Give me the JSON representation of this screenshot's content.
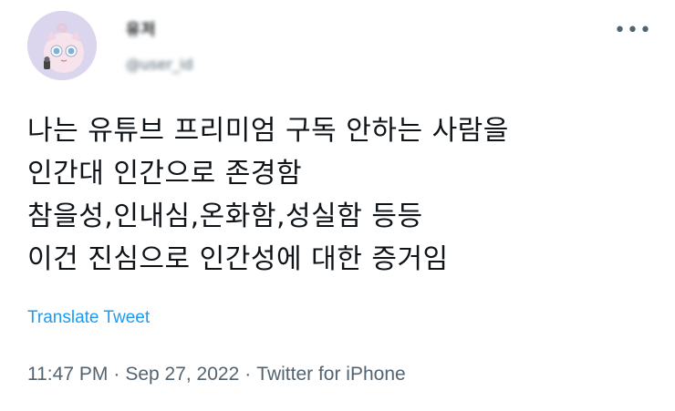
{
  "user": {
    "name": "유저",
    "handle": "@user_id"
  },
  "icons": {
    "more": "more-horizontal-icon",
    "avatar": "avatar-image"
  },
  "tweet": {
    "lines": [
      "나는 유튜브 프리미엄 구독 안하는 사람을",
      "인간대 인간으로 존경함",
      "참을성,인내심,온화함,성실함 등등",
      "이건 진심으로 인간성에 대한 증거임"
    ],
    "translate_label": "Translate Tweet"
  },
  "meta": {
    "time": "11:47 PM",
    "separator": "·",
    "date": "Sep 27, 2022",
    "source": "Twitter for iPhone"
  },
  "colors": {
    "link": "#1d9bf0",
    "secondary_text": "#536471",
    "primary_text": "#0f1419",
    "avatar_bg": "#dcd5ee"
  }
}
